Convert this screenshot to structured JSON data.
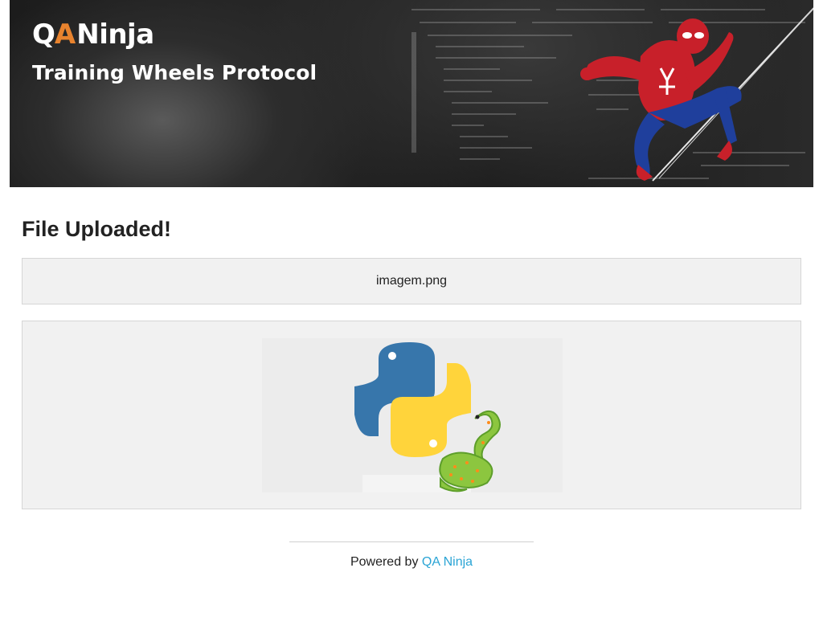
{
  "banner": {
    "logo_prefix": "Q",
    "logo_accent": "A",
    "logo_name": "Ninja",
    "subtitle": "Training Wheels Protocol",
    "hero_image": "spider-man-hero",
    "background": "code-screen"
  },
  "main": {
    "title": "File Uploaded!",
    "filename": "imagem.png",
    "preview_image": "python-logo-with-snake"
  },
  "footer": {
    "powered_by": "Powered by",
    "link_text": "QA Ninja"
  },
  "colors": {
    "accent_orange": "#e8832e",
    "link": "#2aa4d5",
    "panel_bg": "#f1f1f1",
    "panel_border": "#d6d6d6",
    "python_blue": "#3776ab",
    "python_yellow": "#ffd43b"
  }
}
